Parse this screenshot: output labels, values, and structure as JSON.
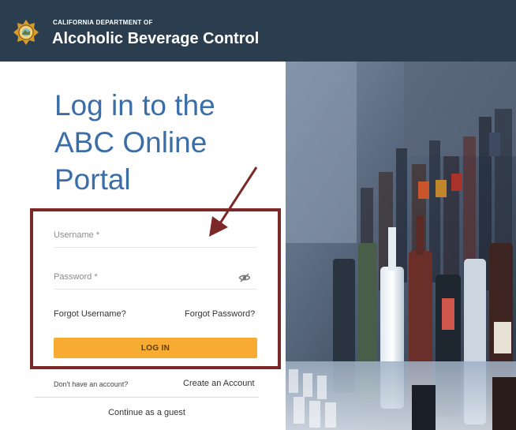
{
  "header": {
    "dept_small": "CALIFORNIA DEPARTMENT OF",
    "dept_big": "Alcoholic Beverage Control",
    "seal_icon": "california-seal-icon",
    "bg_color": "#2b3e50"
  },
  "login": {
    "title_line1": "Log in to the",
    "title_line2": "ABC Online",
    "title_line3": "Portal",
    "username_label": "Username *",
    "password_label": "Password *",
    "eye_icon": "eye-slash-icon",
    "forgot_username": "Forgot Username?",
    "forgot_password": "Forgot Password?",
    "login_button": "LOG IN",
    "no_account_text": "Don't have an account?",
    "create_account": "Create an Account",
    "guest": "Continue as a guest",
    "accent_color": "#f7ab32",
    "title_color": "#3b6ea8"
  },
  "annotation": {
    "highlight_color": "#7d2828",
    "arrow_icon": "arrow-pointer-icon"
  },
  "photo": {
    "subject": "bar-bottles-photo"
  }
}
